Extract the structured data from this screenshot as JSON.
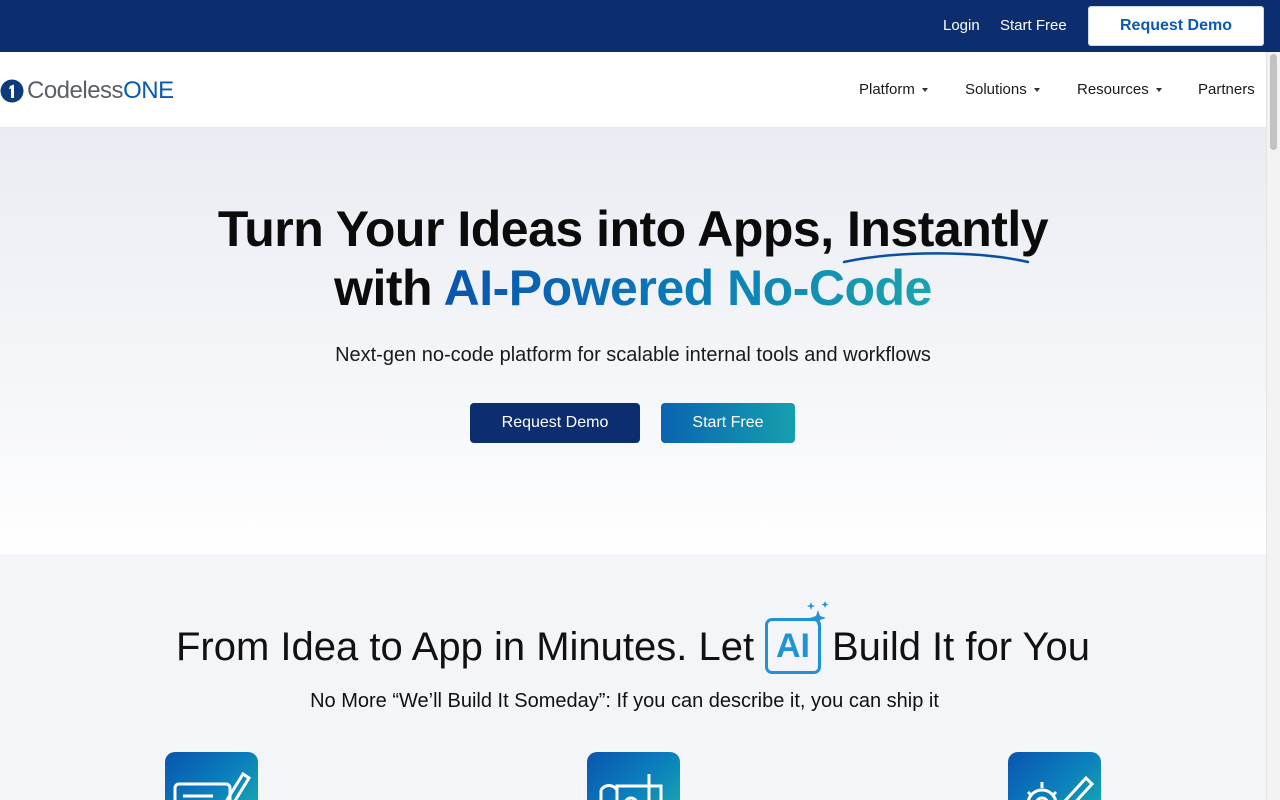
{
  "topbar": {
    "login": "Login",
    "start_free": "Start Free",
    "request_demo": "Request Demo"
  },
  "logo": {
    "text": "Codeless",
    "text_accent": "ONE"
  },
  "nav": {
    "items": [
      {
        "label": "Platform",
        "dropdown": true
      },
      {
        "label": "Solutions",
        "dropdown": true
      },
      {
        "label": "Resources",
        "dropdown": true
      },
      {
        "label": "Partners",
        "dropdown": false
      }
    ]
  },
  "hero": {
    "line1": "Turn Your Ideas into Apps, Instantly",
    "line2_prefix": "with ",
    "line2_highlight": "AI-Powered No-Code",
    "subtitle": "Next-gen no-code platform for scalable internal tools and workflows",
    "cta_demo": "Request Demo",
    "cta_free": "Start Free"
  },
  "section2": {
    "title_part1": "From Idea to App in Minutes. Let",
    "ai_badge": "AI",
    "title_part2": "Build It for You",
    "subtitle": "No More “We’ll Build It Someday”: If you can describe it, you can ship it",
    "feature_icons": [
      "edit-board-icon",
      "blueprint-icon",
      "gear-pencil-icon"
    ]
  },
  "colors": {
    "topbar_bg": "#0c2d6e",
    "brand_blue": "#0a5bb0",
    "teal": "#19a8ae"
  }
}
